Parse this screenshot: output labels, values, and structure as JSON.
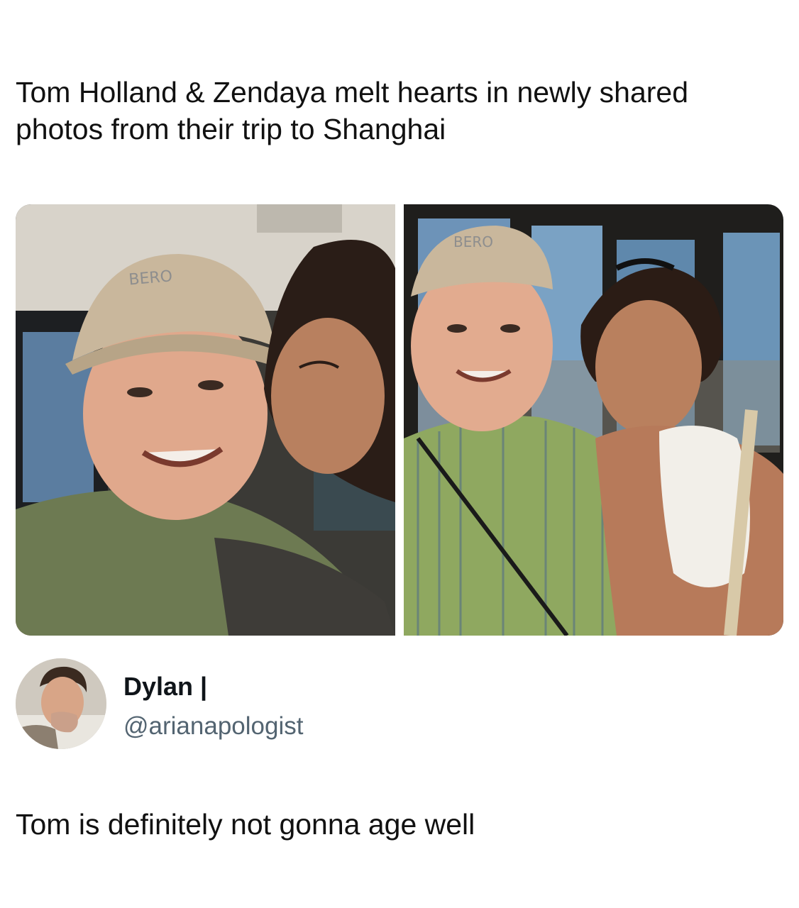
{
  "headline": "Tom Holland & Zendaya melt hearts in newly shared photos from their trip to Shanghai",
  "photos": [
    {
      "cap_text": "BERO"
    },
    {
      "cap_text": "BERO"
    }
  ],
  "author": {
    "display_name": "Dylan |",
    "handle": "@arianapologist"
  },
  "tweet_text": "Tom is definitely not gonna age well",
  "colors": {
    "text": "#111111",
    "handle": "#536471",
    "background": "#ffffff"
  }
}
